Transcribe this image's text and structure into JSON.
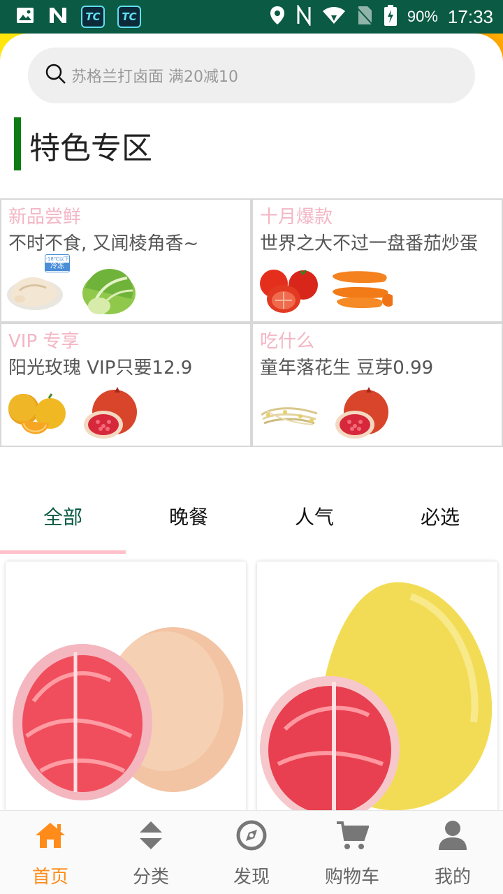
{
  "status_bar": {
    "battery": "90%",
    "time": "17:33"
  },
  "search": {
    "placeholder": "苏格兰打卤面 满20减10"
  },
  "section": {
    "title": "特色专区"
  },
  "cards": [
    {
      "title": "新品尝鲜",
      "subtitle": "不时不食, 又闻棱角香~",
      "images": [
        "chicken",
        "lettuce"
      ],
      "badge": "冷冻",
      "badge_small": "-18℃以下"
    },
    {
      "title": "十月爆款",
      "subtitle": "世界之大不过一盘番茄炒蛋",
      "images": [
        "tomatoes",
        "carrots"
      ]
    },
    {
      "title": "VIP 专享",
      "subtitle": "阳光玫瑰 VIP只要12.9",
      "images": [
        "oranges",
        "pomegranate"
      ]
    },
    {
      "title": "吃什么",
      "subtitle": "童年落花生 豆芽0.99",
      "images": [
        "bean-sprouts",
        "pomegranate"
      ]
    }
  ],
  "tabs": [
    {
      "label": "全部",
      "active": true
    },
    {
      "label": "晚餐",
      "active": false
    },
    {
      "label": "人气",
      "active": false
    },
    {
      "label": "必选",
      "active": false
    }
  ],
  "products": [
    {
      "image": "pink-pomelo"
    },
    {
      "image": "yellow-pomelo"
    }
  ],
  "bottom_nav": [
    {
      "label": "首页",
      "icon": "home-icon",
      "active": true
    },
    {
      "label": "分类",
      "icon": "sort-icon",
      "active": false
    },
    {
      "label": "发现",
      "icon": "compass-icon",
      "active": false
    },
    {
      "label": "购物车",
      "icon": "cart-icon",
      "active": false
    },
    {
      "label": "我的",
      "icon": "user-icon",
      "active": false
    }
  ],
  "colors": {
    "status_bar": "#0b5a43",
    "accent": "#ff8c1a",
    "card_title": "#f3b6c4",
    "section_bar": "#0e7b14",
    "tab_active": "#0b5a43"
  }
}
